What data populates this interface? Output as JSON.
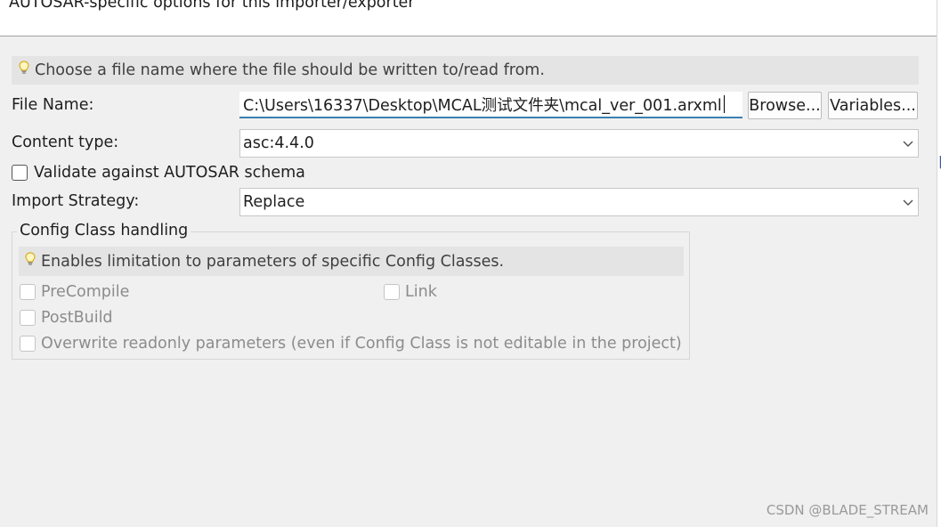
{
  "header": {
    "title": "AUTOSAR-specific options for this importer/exporter"
  },
  "hint": {
    "text": "Choose a file name where the file should be written to/read from."
  },
  "file_name": {
    "label": "File Name:",
    "value": "C:\\Users\\16337\\Desktop\\MCAL测试文件夹\\mcal_ver_001.arxml",
    "browse_label": "Browse...",
    "variables_label": "Variables..."
  },
  "content_type": {
    "label": "Content type:",
    "value": "asc:4.4.0"
  },
  "validate": {
    "label": "Validate against AUTOSAR schema",
    "checked": false
  },
  "import_strategy": {
    "label": "Import Strategy:",
    "value": "Replace"
  },
  "config_class": {
    "title": "Config Class handling",
    "hint": "Enables limitation to parameters of specific Config Classes.",
    "options": {
      "precompile": "PreCompile",
      "link": "Link",
      "postbuild": "PostBuild",
      "overwrite": "Overwrite readonly parameters (even if Config Class is not editable in the project)"
    }
  },
  "icons": {
    "hint": "lightbulb-icon",
    "dropdown": "chevron-down-icon"
  },
  "watermark": "CSDN @BLADE_STREAM"
}
